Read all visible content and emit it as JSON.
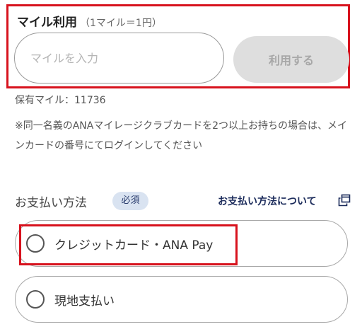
{
  "mile_section": {
    "title": "マイル利用",
    "rate_note": "（1マイル＝1円）",
    "input_placeholder": "マイルを入力",
    "use_button_label": "利用する"
  },
  "held_miles": "保有マイル：11736",
  "notice": "※同一名義のANAマイレージクラブカードを2つ以上お持ちの場合は、メインカードの番号にてログインしてください",
  "payment": {
    "label": "お支払い方法",
    "required_badge": "必須",
    "about_link": "お支払い方法について",
    "about_link_icon": "external-window-icon",
    "options": [
      {
        "label": "クレジットカード・ANA Pay",
        "selected": false
      },
      {
        "label": "現地支払い",
        "selected": false
      }
    ]
  },
  "colors": {
    "highlight_red": "#d7121d",
    "badge_bg": "#d9e3f1",
    "link_navy": "#1a2a5a",
    "disabled_button_bg": "#dedede"
  }
}
